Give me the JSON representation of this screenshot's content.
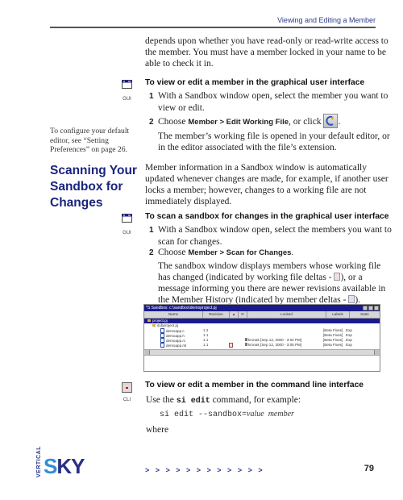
{
  "header": {
    "section_title": "Viewing and Editing a Member"
  },
  "intro_paragraph": {
    "line1": "depends upon whether you have read-only or read-write access to",
    "line2": "the member. You must have a member locked in your name to be",
    "line3": "able to check it in."
  },
  "proc_gui_edit": {
    "icon_label": "GUI",
    "heading": "To view or edit a member in the graphical user interface",
    "step1_num": "1",
    "step1_line1": "With a Sandbox window open, select the member you want to",
    "step1_line2": "view or edit.",
    "step2_num": "2",
    "step2_prefix": "Choose ",
    "step2_menu": "Member > Edit Working File",
    "step2_suffix": ", or click",
    "step2_end": ".",
    "result_line1": "The member’s working file is opened in your default editor, or",
    "result_line2": "in the editor associated with the file’s extension."
  },
  "side_note": {
    "line1": "To configure your default",
    "line2": "editor, see “Setting",
    "line3": "Preferences” on page 26."
  },
  "section": {
    "title_line1": "Scanning Your",
    "title_line2": "Sandbox for",
    "title_line3": "Changes",
    "para_line1": "Member information in a Sandbox window is automatically",
    "para_line2": "updated whenever changes are made, for example, if another user",
    "para_line3": "locks a member; however, changes to a working file are not",
    "para_line4": "immediately displayed."
  },
  "proc_gui_scan": {
    "icon_label": "GUI",
    "heading": "To scan a sandbox for changes in the graphical user interface",
    "step1_num": "1",
    "step1_line1": "With a Sandbox window open, select the members you want to",
    "step1_line2": "scan for changes.",
    "step2_num": "2",
    "step2_prefix": "Choose ",
    "step2_menu": "Member > Scan for Changes",
    "step2_end": ".",
    "result_line1": "The sandbox window displays members whose working file",
    "result_line2a": "has changed (indicated by working file deltas - ",
    "result_line2b": "), or a",
    "result_line3": "message informing you there are newer revisions available in",
    "result_line4a": "the Member History (indicated by member deltas - ",
    "result_line4b": ")."
  },
  "sandbox_window": {
    "title": "*S Sandbox: c:\\sandbox\\demoproject.pj",
    "columns": [
      "Name",
      "Revision",
      "▲",
      "⟳",
      "Locked",
      "Labels",
      "State"
    ],
    "selected_row": "project.pj",
    "subproject": "subproject.pj",
    "rows": [
      {
        "name": "demoapp.c",
        "revision": "1.2",
        "locked": "",
        "labels": "[Beta Fixes]",
        "state": "Exp",
        "wf_delta": false
      },
      {
        "name": "demoapp.h",
        "revision": "1.1",
        "locked": "",
        "labels": "[Beta Fixes]",
        "state": "Exp",
        "wf_delta": false
      },
      {
        "name": "demoapp.rc",
        "revision": "1.1",
        "locked": "kronak [Sep 12, 2000 - 3:02 PM]",
        "labels": "[Beta Fixes]",
        "state": "Exp",
        "wf_delta": false
      },
      {
        "name": "demoapp.rsl",
        "revision": "1.1",
        "locked": "kronak [Sep 12, 2000 - 3:05 PM]",
        "labels": "[Beta Fixes]",
        "state": "Exp",
        "wf_delta": true
      }
    ]
  },
  "proc_cli_edit": {
    "icon_label": "CLI",
    "heading": "To view or edit a member in the command line interface",
    "use_prefix": "Use the ",
    "command": "si edit",
    "use_suffix": " command, for example:",
    "example_cmd": "si edit --sandbox=",
    "example_value": "value",
    "example_member": "member",
    "where": "where"
  },
  "footer": {
    "logo_small": "VERTICAL",
    "logo_big": "SKY",
    "arrows": ">   >   >   >   >   >   >   >   >   >   >   >",
    "page_number": "79"
  }
}
